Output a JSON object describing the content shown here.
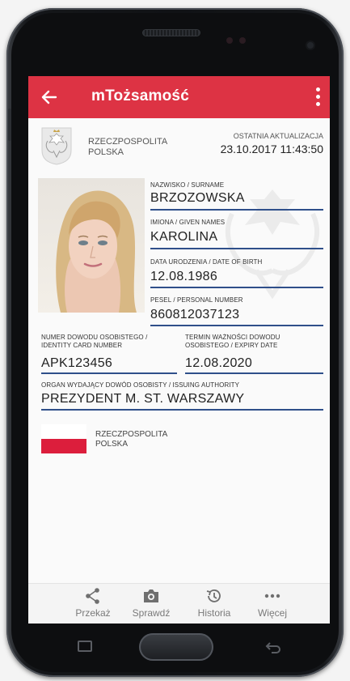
{
  "app": {
    "title": "mTożsamość"
  },
  "header": {
    "country_line1": "RZECZPOSPOLITA",
    "country_line2": "POLSKA",
    "update_label": "OSTATNIA AKTUALIZACJA",
    "update_value": "23.10.2017 11:43:50"
  },
  "fields": {
    "surname_label": "NAZWISKO / SURNAME",
    "surname": "BRZOZOWSKA",
    "given_label": "IMIONA / GIVEN NAMES",
    "given": "KAROLINA",
    "dob_label": "DATA URODZENIA / DATE OF BIRTH",
    "dob": "12.08.1986",
    "pesel_label": "PESEL / PERSONAL NUMBER",
    "pesel": "860812037123",
    "idnum_label_1": "NUMER DOWODU OSOBISTEGO /",
    "idnum_label_2": "IDENTITY CARD NUMBER",
    "idnum": "APK123456",
    "expiry_label_1": "TERMIN WAŻNOŚCI DOWODU",
    "expiry_label_2": "OSOBISTEGO / EXPIRY DATE",
    "expiry": "12.08.2020",
    "authority_label": "ORGAN WYDAJĄCY DOWÓD OSOBISTY / ISSUING AUTHORITY",
    "authority": "PREZYDENT M. ST. WARSZAWY"
  },
  "flag_caption": {
    "line1": "RZECZPOSPOLITA",
    "line2": "POLSKA"
  },
  "nav": [
    {
      "label": "Przekaż",
      "icon": "share-icon"
    },
    {
      "label": "Sprawdź",
      "icon": "camera-icon"
    },
    {
      "label": "Historia",
      "icon": "history-icon"
    },
    {
      "label": "Więcej",
      "icon": "more-horizontal-icon"
    }
  ],
  "colors": {
    "accent": "#dd3344",
    "underline": "#2f4f8a",
    "flag_red": "#dc1e3c"
  }
}
